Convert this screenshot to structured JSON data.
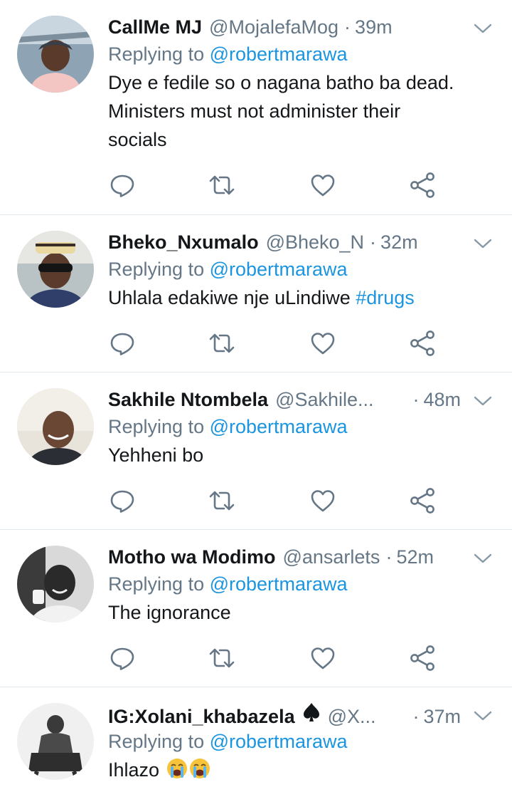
{
  "icons": {
    "reply": "reply-icon",
    "retweet": "retweet-icon",
    "like": "like-icon",
    "share": "share-icon",
    "caret": "chevron-down-icon"
  },
  "colors": {
    "name": "#14171a",
    "muted": "#657786",
    "link": "#1b95e0",
    "divider": "#e1e8ed"
  },
  "tweets": [
    {
      "display_name": "CallMe MJ",
      "handle": "@MojalefaMog",
      "separator": "·",
      "time": "39m",
      "replying_prefix": "Replying to ",
      "replying_to": "@robertmarawa",
      "text_lines": [
        "Dye e fedile so o nagana batho ba dead.",
        "Ministers must not administer their",
        "socials"
      ]
    },
    {
      "display_name": "Bheko_Nxumalo",
      "handle": "@Bheko_N",
      "separator": "·",
      "time": "32m",
      "replying_prefix": "Replying to ",
      "replying_to": "@robertmarawa",
      "text": "Uhlala edakiwe nje uLindiwe ",
      "hashtag": "#drugs"
    },
    {
      "display_name": "Sakhile Ntombela",
      "handle": "@Sakhile...",
      "separator": "·",
      "time": "48m",
      "replying_prefix": "Replying to ",
      "replying_to": "@robertmarawa",
      "text": "Yehheni bo"
    },
    {
      "display_name": "Motho wa Modimo",
      "handle": "@ansarlets",
      "separator": "·",
      "time": "52m",
      "replying_prefix": "Replying to ",
      "replying_to": "@robertmarawa",
      "text": "The ignorance"
    },
    {
      "display_name": "IG:Xolani_khabazela",
      "name_emoji": "spade-suit-icon",
      "handle": "@X...",
      "separator": "·",
      "time": "37m",
      "replying_prefix": "Replying to ",
      "replying_to": "@robertmarawa",
      "text": "Ihlazo",
      "text_emoji": [
        "loudly-crying-face-icon",
        "loudly-crying-face-icon"
      ]
    }
  ]
}
